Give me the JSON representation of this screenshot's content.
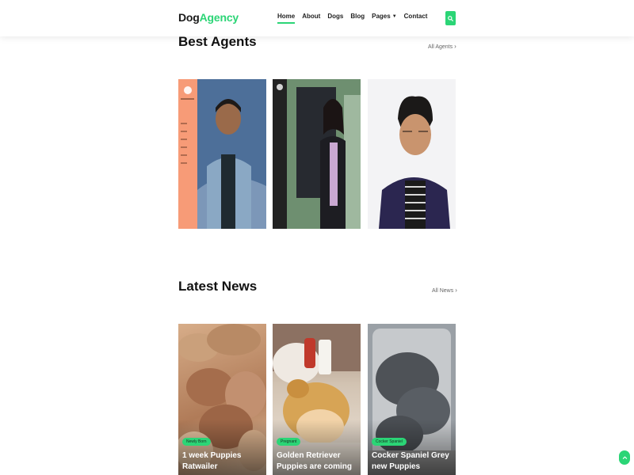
{
  "header": {
    "logo_part1": "Dog",
    "logo_part2": "Agency",
    "nav": [
      "Home",
      "About",
      "Dogs",
      "Blog",
      "Pages",
      "Contact"
    ],
    "active_nav": "Home",
    "accent_color": "#2bd576"
  },
  "agents": {
    "title": "Best Agents",
    "link": "All Agents"
  },
  "news": {
    "title": "Latest News",
    "link": "All News",
    "items": [
      {
        "tag": "Newly Born",
        "title": "1 week Puppies Ratwailer"
      },
      {
        "tag": "Pregnant",
        "title": "Golden Retriever Puppies are coming"
      },
      {
        "tag": "Cocker Spaniel",
        "title": "Cocker Spaniel Grey new Puppies"
      }
    ]
  }
}
